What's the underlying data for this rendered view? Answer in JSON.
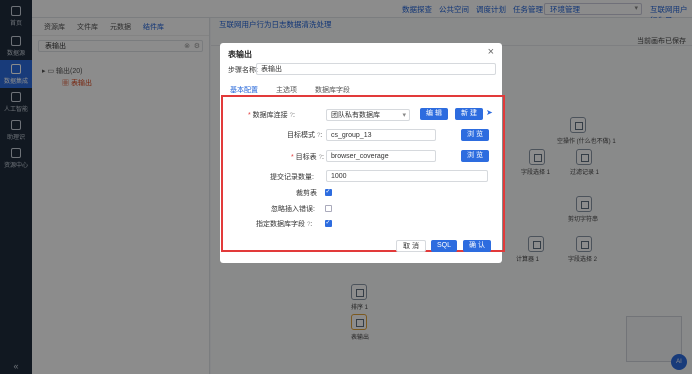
{
  "nav": {
    "items": [
      {
        "label": "首页",
        "icon": "home-icon"
      },
      {
        "label": "数据源",
        "icon": "database-icon"
      },
      {
        "label": "数据集成",
        "icon": "integration-icon"
      },
      {
        "label": "人工智能",
        "icon": "ai-icon"
      },
      {
        "label": "助理识",
        "icon": "assistant-icon"
      },
      {
        "label": "资源中心",
        "icon": "resource-icon"
      }
    ],
    "collapse": "«"
  },
  "header": {
    "menu": [
      "数据探查",
      "公共空间",
      "调度计划",
      "任务管理",
      "环境管理"
    ],
    "app_title": "互联网用户行为日"
  },
  "left_panel": {
    "tabs": [
      "资源库",
      "文件库",
      "元数据",
      "结件库"
    ],
    "active_tab": "结件库",
    "search_value": "表输出",
    "tree_parent": "输出(20)",
    "tree_leaf": "表输出"
  },
  "canvas": {
    "tab_title": "互联网用户行为日志数据清洗处理",
    "saved_status": "当前画布已保存",
    "nodes": [
      {
        "label": "空操作 (什么也不做) 1"
      },
      {
        "label": "字段选择 1"
      },
      {
        "label": "过滤记录 1"
      },
      {
        "label": "剪切字符串"
      },
      {
        "label": "字段选择 2"
      },
      {
        "label": "计算器 1"
      },
      {
        "label": "排序 1"
      },
      {
        "label": "表输出"
      }
    ],
    "ai_badge": "AI"
  },
  "modal": {
    "title": "表输出",
    "step_name_label": "步骤名称:",
    "step_name_value": "表输出",
    "tabs": [
      "基本配置",
      "主选项",
      "数据库字段"
    ],
    "active_tab": "基本配置",
    "db_conn_label": "数据库连接",
    "db_conn_value": "团队私有数据库",
    "edit_label": "编 辑",
    "new_label": "新 建",
    "schema_label": "目标模式",
    "schema_value": "cs_group_13",
    "browse_label": "浏 览",
    "table_label": "目标表",
    "table_value": "browser_coverage",
    "commit_label": "提交记录数量:",
    "commit_value": "1000",
    "truncate_label": "裁剪表",
    "ignore_label": "忽略插入错误:",
    "specify_label": "指定数据库字段",
    "cancel_label": "取 消",
    "sql_label": "SQL",
    "ok_label": "确 认"
  }
}
